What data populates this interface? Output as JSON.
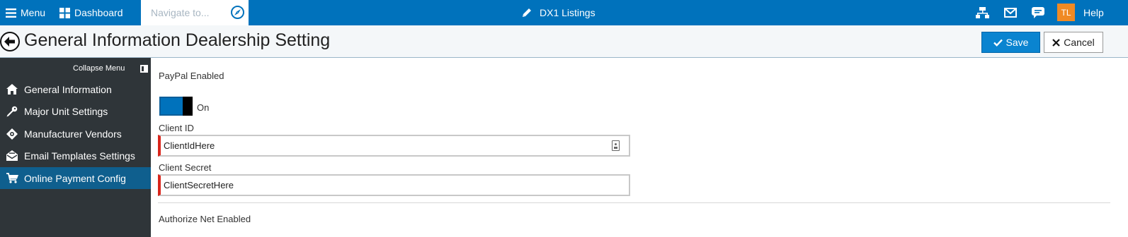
{
  "topbar": {
    "menu_label": "Menu",
    "dashboard_label": "Dashboard",
    "search_placeholder": "Navigate to...",
    "app_title": "DX1 Listings",
    "avatar_initials": "TL",
    "help_label": "Help",
    "icons": [
      "hamburger-icon",
      "dashboard-grid-icon",
      "compass-icon",
      "pencil-icon",
      "org-chart-icon",
      "mail-icon",
      "chat-icon"
    ]
  },
  "header": {
    "title": "General Information Dealership Setting",
    "save_label": "Save",
    "cancel_label": "Cancel"
  },
  "sidebar": {
    "collapse_label": "Collapse Menu",
    "items": [
      {
        "label": "General Information",
        "icon": "home-icon",
        "active": false
      },
      {
        "label": "Major Unit Settings",
        "icon": "key-icon",
        "active": false
      },
      {
        "label": "Manufacturer Vendors",
        "icon": "crosshair-icon",
        "active": false
      },
      {
        "label": "Email Templates Settings",
        "icon": "envelope-open-icon",
        "active": false
      },
      {
        "label": "Online Payment Config",
        "icon": "cart-icon",
        "active": true
      }
    ]
  },
  "form": {
    "paypal_enabled_label": "PayPal Enabled",
    "toggle_state": "On",
    "client_id_label": "Client ID",
    "client_id_value": "ClientIdHere",
    "client_secret_label": "Client Secret",
    "client_secret_value": "ClientSecretHere",
    "authorize_net_label": "Authorize Net Enabled"
  },
  "colors": {
    "topbar": "#0072bc",
    "sidebar": "#2f3539",
    "sidebar_active": "#0f5f8e",
    "avatar": "#f08a24",
    "required_border": "#d9261c"
  }
}
